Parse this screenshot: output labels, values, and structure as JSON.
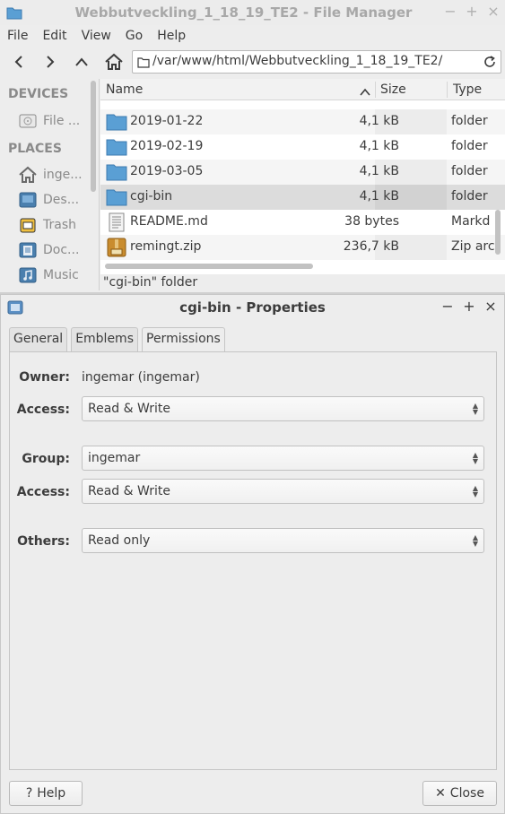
{
  "file_manager": {
    "window_title": "Webbutveckling_1_18_19_TE2 - File Manager",
    "window_buttons": [
      "−",
      "+",
      "×"
    ],
    "menu": [
      "File",
      "Edit",
      "View",
      "Go",
      "Help"
    ],
    "path": "/var/www/html/Webbutveckling_1_18_19_TE2/",
    "sidebar": {
      "devices_heading": "DEVICES",
      "places_heading": "PLACES",
      "devices": [
        {
          "label": "File ...",
          "icon": "drive-icon"
        }
      ],
      "places": [
        {
          "label": "inge...",
          "icon": "home-icon"
        },
        {
          "label": "Des...",
          "icon": "desktop-icon"
        },
        {
          "label": "Trash",
          "icon": "trash-icon"
        },
        {
          "label": "Doc...",
          "icon": "documents-icon"
        },
        {
          "label": "Music",
          "icon": "music-icon"
        }
      ]
    },
    "columns": {
      "name": "Name",
      "size": "Size",
      "type": "Type"
    },
    "rows": [
      {
        "name": "2019-01-22",
        "size": "4,1 kB",
        "type": "folder",
        "icon": "folder-icon"
      },
      {
        "name": "2019-02-19",
        "size": "4,1 kB",
        "type": "folder",
        "icon": "folder-icon"
      },
      {
        "name": "2019-03-05",
        "size": "4,1 kB",
        "type": "folder",
        "icon": "folder-icon"
      },
      {
        "name": "cgi-bin",
        "size": "4,1 kB",
        "type": "folder",
        "icon": "folder-icon",
        "selected": true
      },
      {
        "name": "README.md",
        "size": "38 bytes",
        "type": "Markd",
        "icon": "text-file-icon"
      },
      {
        "name": "remingt.zip",
        "size": "236,7 kB",
        "type": "Zip arc",
        "icon": "archive-icon"
      }
    ],
    "status": "\"cgi-bin\" folder"
  },
  "properties": {
    "title": "cgi-bin - Properties",
    "window_buttons": [
      "−",
      "+",
      "×"
    ],
    "tabs": [
      "General",
      "Emblems",
      "Permissions"
    ],
    "active_tab": "Permissions",
    "owner_label": "Owner:",
    "owner_value": "ingemar (ingemar)",
    "owner_access_label": "Access:",
    "owner_access": "Read & Write",
    "group_label": "Group:",
    "group_value": "ingemar",
    "group_access_label": "Access:",
    "group_access": "Read & Write",
    "others_label": "Others:",
    "others_access": "Read only",
    "help_button": "Help",
    "close_button": "Close"
  },
  "colors": {
    "folder": "#5a9fd4",
    "selection": "#dcdcdc",
    "window_bg": "#ededed"
  }
}
